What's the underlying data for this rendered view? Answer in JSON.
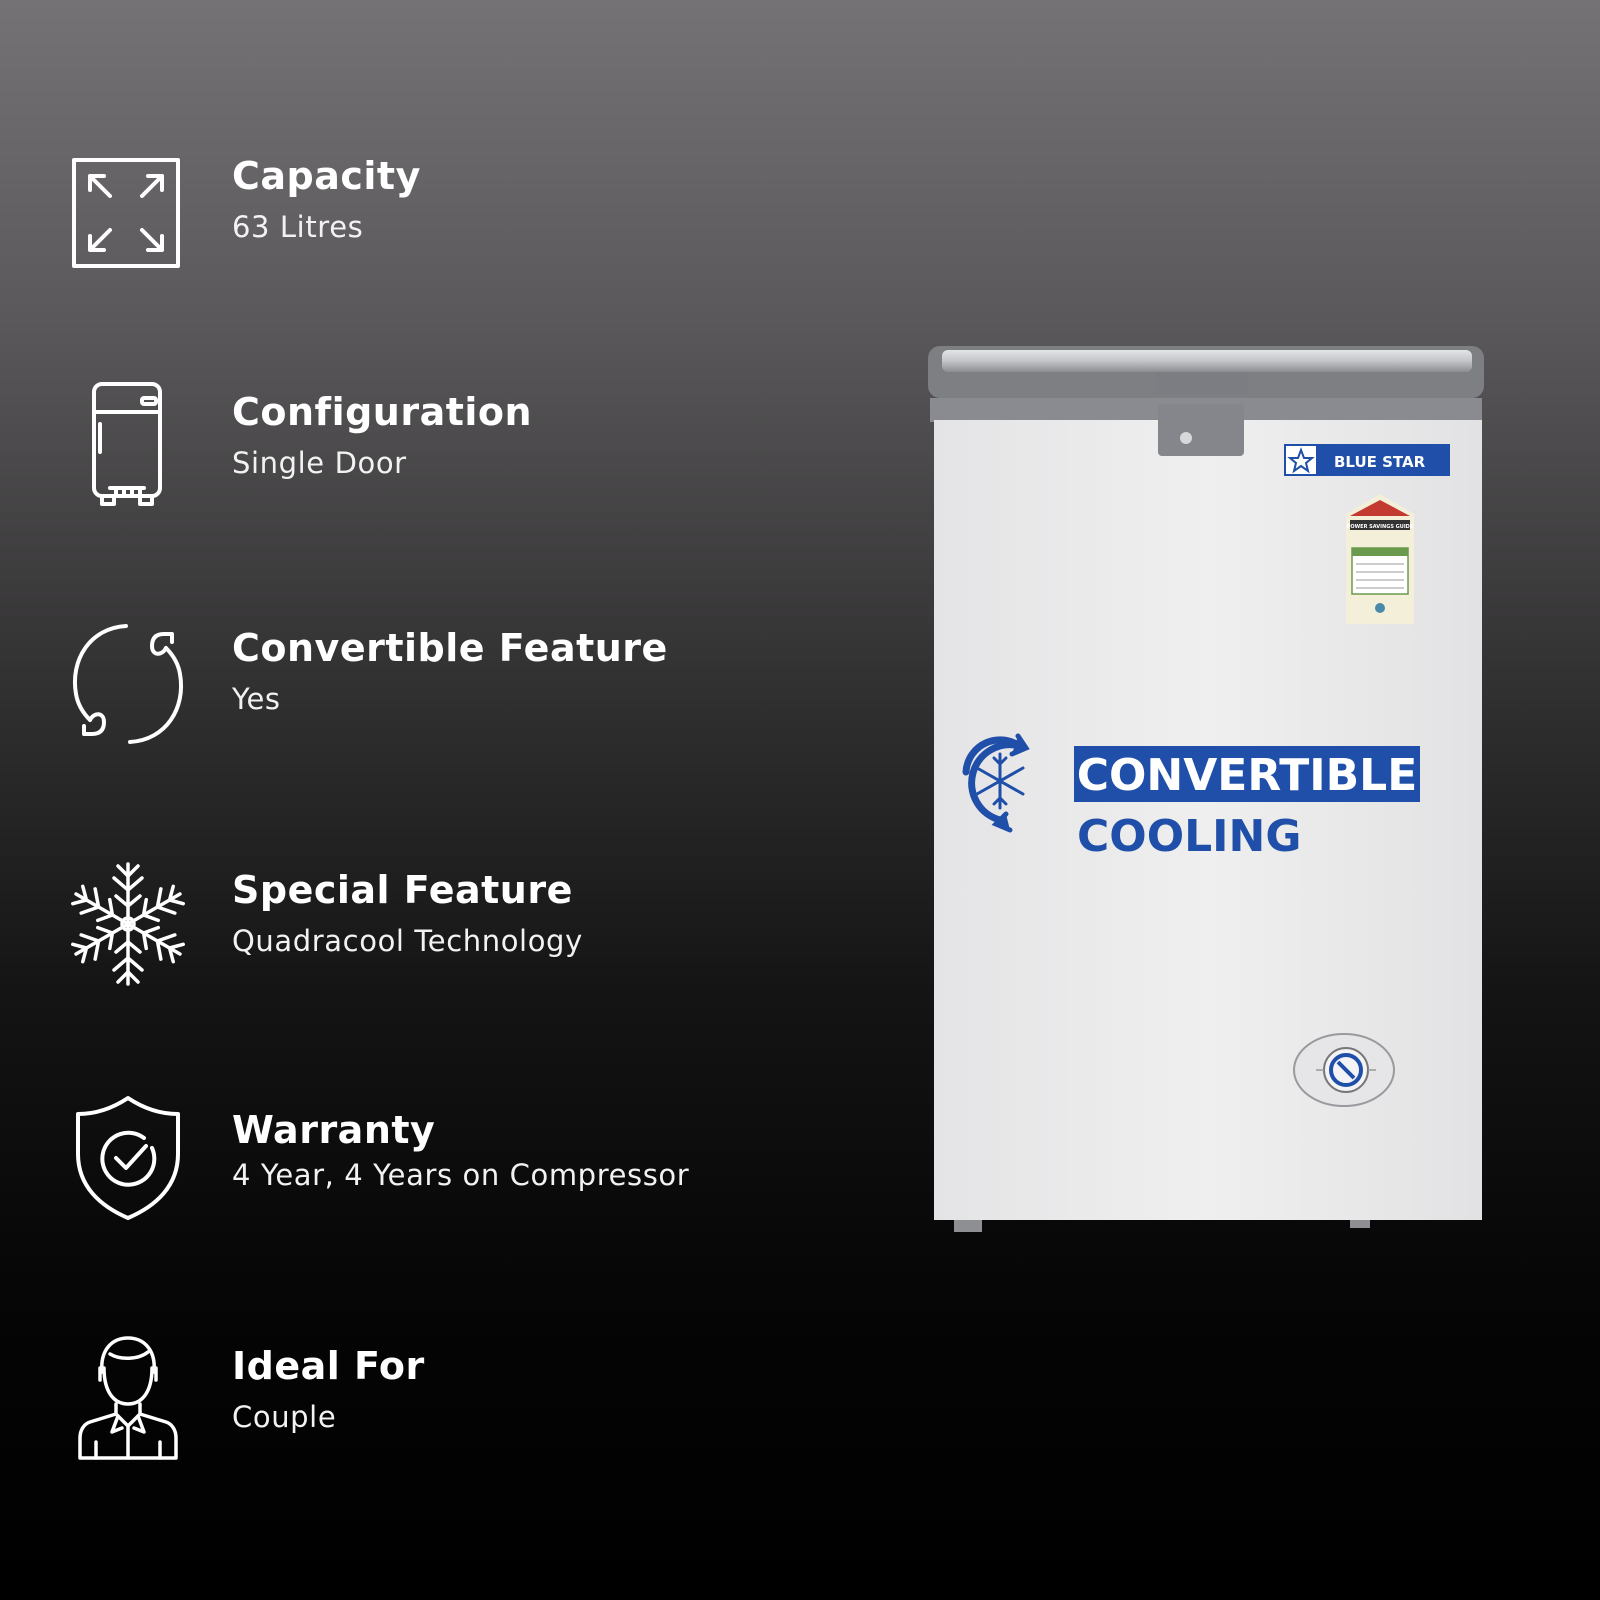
{
  "features": [
    {
      "title": "Capacity",
      "value": "63 Litres",
      "icon": "expand-arrows-icon"
    },
    {
      "title": "Configuration",
      "value": "Single Door",
      "icon": "refrigerator-icon"
    },
    {
      "title": "Convertible Feature",
      "value": "Yes",
      "icon": "convertible-arrows-icon"
    },
    {
      "title": "Special Feature",
      "value": "Quadracool Technology",
      "icon": "snowflake-icon"
    },
    {
      "title": "Warranty",
      "value": "4 Year, 4 Years on Compressor",
      "icon": "shield-check-icon"
    },
    {
      "title": "Ideal For",
      "value": "Couple",
      "icon": "person-icon"
    }
  ],
  "product": {
    "brand": "BLUE STAR",
    "badge_line1": "CONVERTIBLE",
    "badge_line2": "COOLING",
    "energy_label_text": "POWER SAVINGS GUIDE"
  },
  "colors": {
    "brand_blue": "#1f4fa8",
    "body_white": "#ededee",
    "trim_gray": "#8e8f93"
  }
}
